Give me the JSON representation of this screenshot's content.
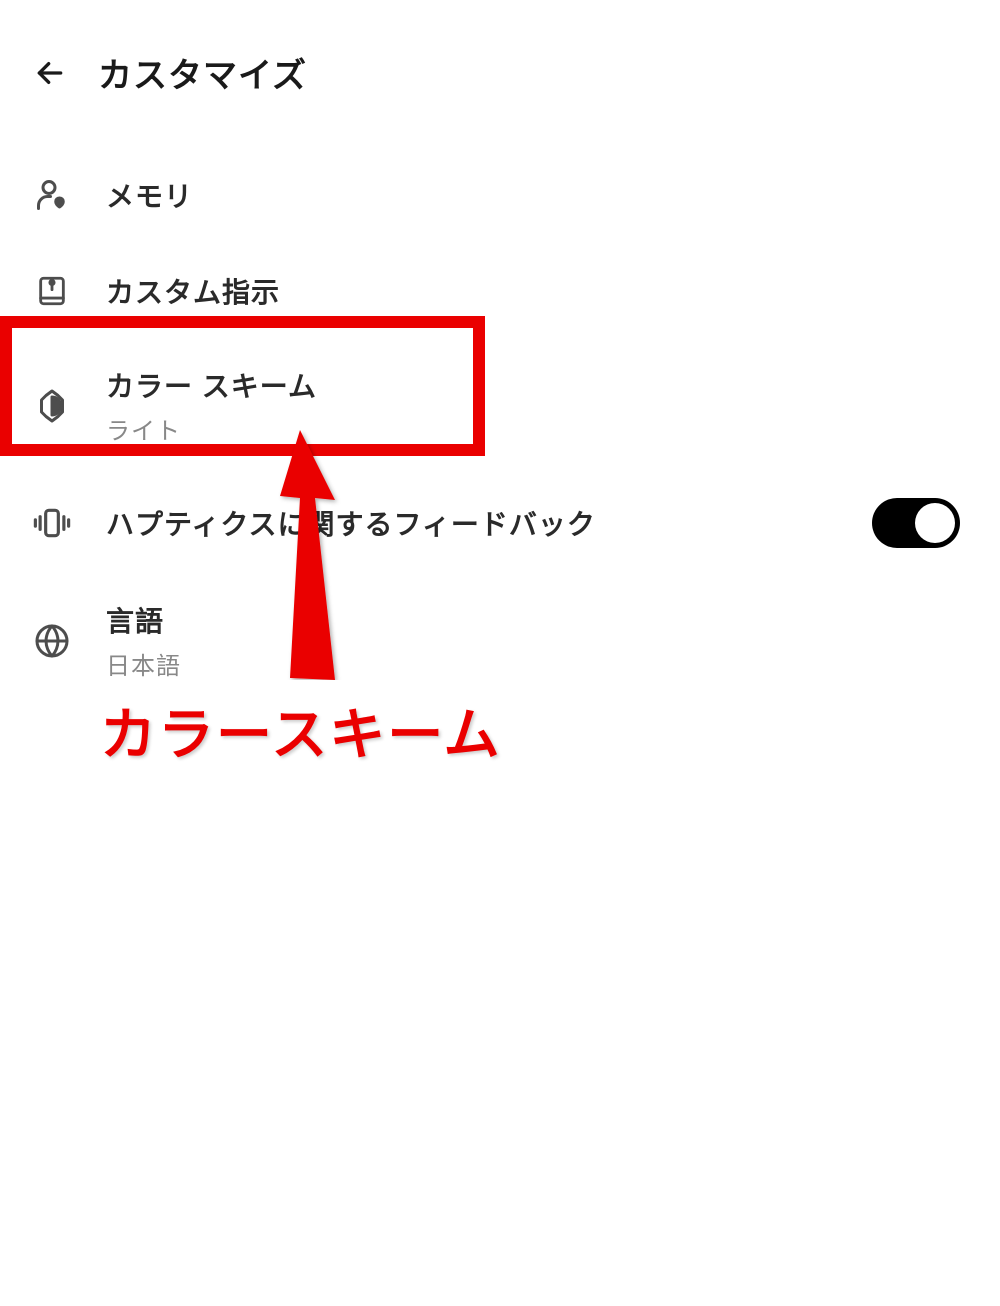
{
  "header": {
    "title": "カスタマイズ"
  },
  "settings": {
    "memory": {
      "label": "メモリ"
    },
    "custom_instructions": {
      "label": "カスタム指示"
    },
    "color_scheme": {
      "label": "カラー スキーム",
      "value": "ライト"
    },
    "haptics": {
      "label": "ハプティクスに関するフィードバック",
      "toggle": "on"
    },
    "language": {
      "label": "言語",
      "value": "日本語"
    }
  },
  "annotation": {
    "text": "カラースキーム"
  }
}
